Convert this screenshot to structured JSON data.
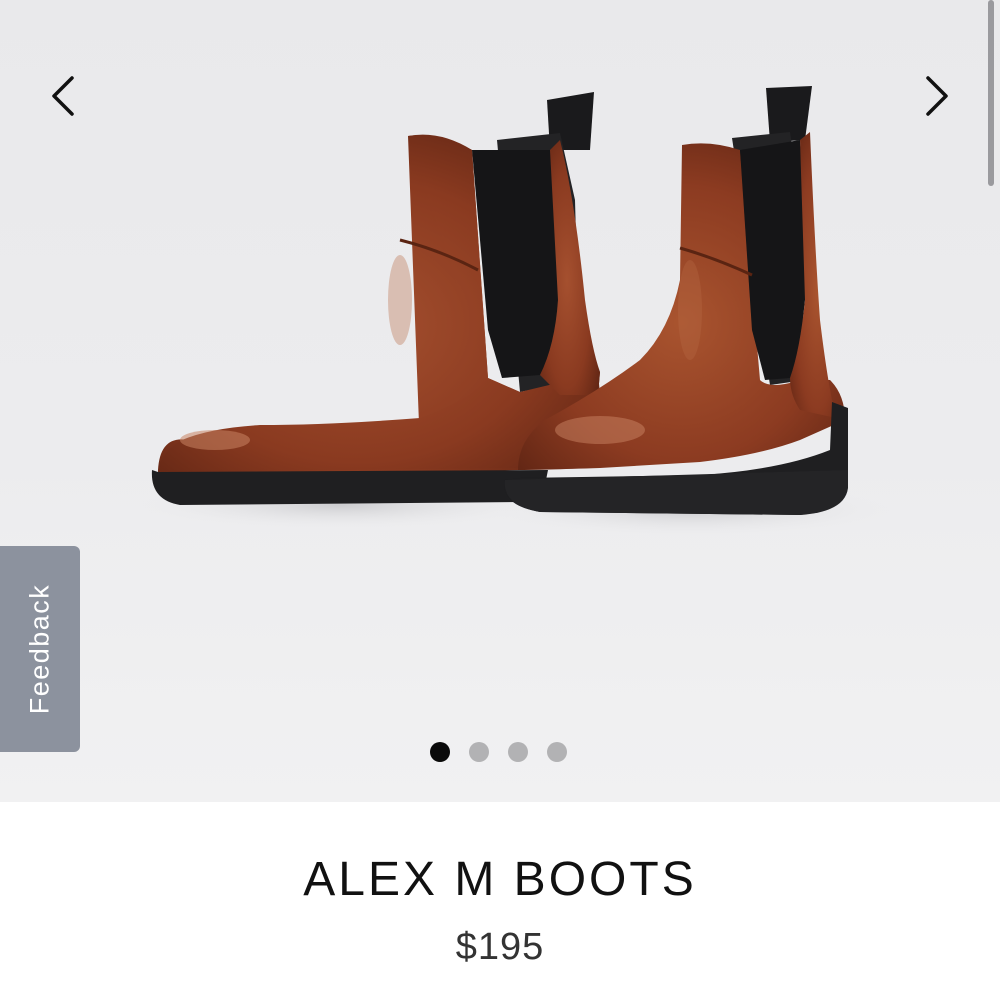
{
  "gallery": {
    "image_icon": "chelsea-boots-photo",
    "prev_icon": "chevron-left-icon",
    "next_icon": "chevron-right-icon",
    "slide_count": 4,
    "active_slide": 1
  },
  "feedback": {
    "label": "Feedback"
  },
  "product": {
    "title": "ALEX M BOOTS",
    "price": "$195"
  },
  "colors": {
    "leather": "#8c3b22",
    "elastic": "#1c1c1e",
    "sole": "#1f1f21",
    "dot_active": "#0a0a0a",
    "dot_inactive": "#b2b2b4",
    "feedback_tab": "#8c929e"
  }
}
